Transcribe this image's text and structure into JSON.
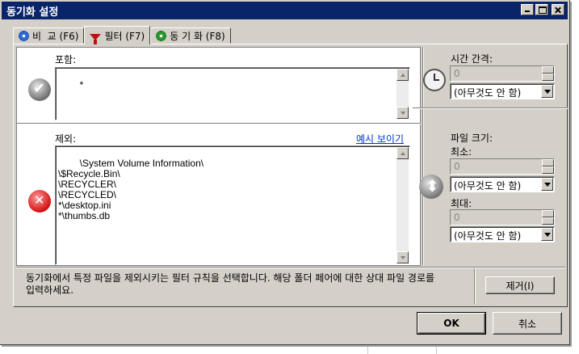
{
  "window": {
    "title": "동기화 설정"
  },
  "tabs": [
    {
      "label": "비  교 (F6)",
      "icon": "gear-icon"
    },
    {
      "label": "필터 (F7)",
      "icon": "funnel-icon"
    },
    {
      "label": "동 기 화 (F8)",
      "icon": "gear-icon"
    }
  ],
  "filter": {
    "include_label": "포함:",
    "include_text": "*",
    "exclude_label": "제외:",
    "example_link": "예시 보이기",
    "exclude_text": "\\System Volume Information\\\n\\$Recycle.Bin\\\n\\RECYCLER\\\n\\RECYCLED\\\n*\\desktop.ini\n*\\thumbs.db"
  },
  "time_span": {
    "label": "시간 간격:",
    "value": "0",
    "unit": "(아무것도 안 함)"
  },
  "file_size": {
    "label": "파일 크기:",
    "min_label": "최소:",
    "min_value": "0",
    "min_unit": "(아무것도 안 함)",
    "max_label": "최대:",
    "max_value": "0",
    "max_unit": "(아무것도 안 함)"
  },
  "description": "동기화에서 특정 파일을 제외시키는 필터 규칙을 선택합니다. 해당 폴더 페어에 대한 상대 파일 경로를\n입력하세요.",
  "buttons": {
    "clear": "제거(I)",
    "ok": "OK",
    "cancel": "취소"
  }
}
